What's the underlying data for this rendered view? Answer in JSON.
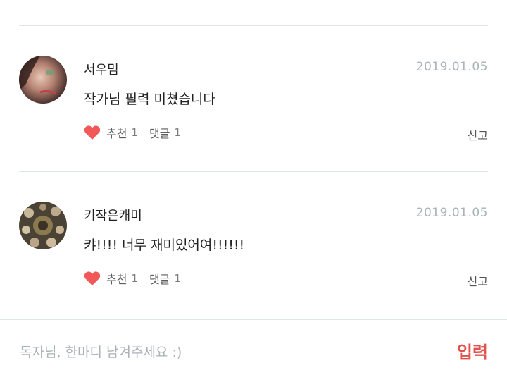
{
  "comments": [
    {
      "username": "서우밈",
      "date": "2019.01.05",
      "text": "작가님 필력 미쳤습니다",
      "like_label": "추천",
      "like_count": "1",
      "reply_label": "댓글",
      "reply_count": "1",
      "report_label": "신고"
    },
    {
      "username": "키작은캐미",
      "date": "2019.01.05",
      "text": "캬!!!! 너무 재미있어여!!!!!!",
      "like_label": "추천",
      "like_count": "1",
      "reply_label": "댓글",
      "reply_count": "1",
      "report_label": "신고"
    }
  ],
  "input": {
    "placeholder": "독자님, 한마디 남겨주세요 :)",
    "value": "",
    "submit_label": "입력"
  },
  "colors": {
    "heart": "#f25858",
    "submit": "#e0524e",
    "divider": "#dde7ea",
    "date": "#a7b4b9"
  },
  "icons": {
    "like": "heart-icon"
  }
}
